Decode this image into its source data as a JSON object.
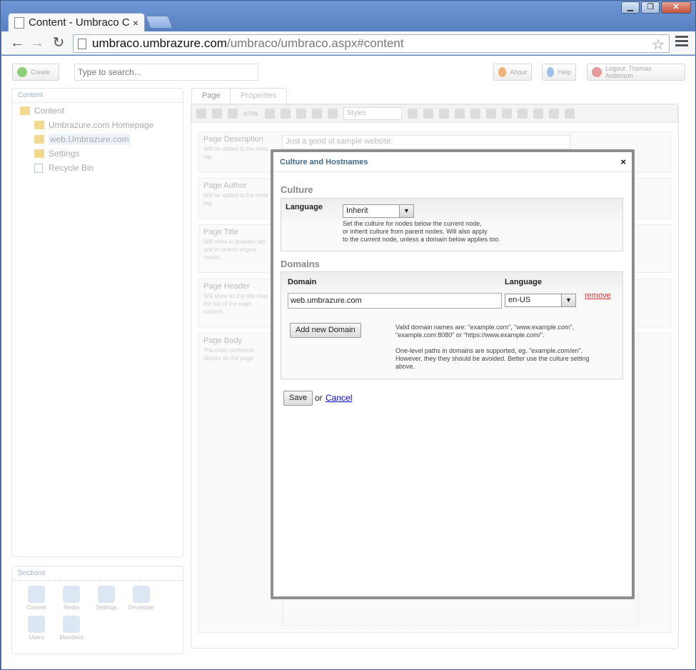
{
  "browser": {
    "tab_title": "Content - Umbraco C",
    "tab_close": "×",
    "url_host": "umbraco.umbrazure.com",
    "url_path": "/umbraco/umbraco.aspx#content",
    "window_buttons": [
      "▁",
      "❐",
      "✕"
    ]
  },
  "topbar": {
    "create_label": "Create",
    "search_placeholder": "Type to search...",
    "about_label": "About",
    "help_label": "Help",
    "logout_label": "Logout: Thomas Anderson"
  },
  "tree": {
    "title": "Content",
    "items": [
      "Content",
      "Umbrazure.com Homepage",
      "web.Umbrazure.com",
      "Settings",
      "Recycle Bin"
    ]
  },
  "sections": {
    "title": "Sections",
    "items": [
      "Content",
      "Media",
      "Settings",
      "Developer",
      "Users",
      "Members"
    ]
  },
  "page_tabs": [
    "Page",
    "Properties"
  ],
  "editor": {
    "styles_label": "Styles",
    "html_label": "HTML"
  },
  "properties": [
    {
      "label": "Page Description",
      "desc": "Will be added to the meta tag.",
      "value": "Just a good ol sample website."
    },
    {
      "label": "Page Author",
      "desc": "Will be added to the meta tag.",
      "value": ""
    },
    {
      "label": "Page Title",
      "desc": "Will show in browser tab and in search engine results.",
      "value": ""
    },
    {
      "label": "Page Header",
      "desc": "Will show as the title near the top of the page content.",
      "value": ""
    },
    {
      "label": "Page Body",
      "desc": "The main content to display on the page.",
      "value": ""
    }
  ],
  "modal": {
    "title": "Culture and Hostnames",
    "close": "×",
    "culture_title": "Culture",
    "language_label": "Language",
    "language_value": "Inherit",
    "language_hint": [
      "Set the culture for nodes below the current node,",
      "or inherit culture from parent nodes. Will also apply",
      "to the current node, unless a domain below applies too."
    ],
    "domains_title": "Domains",
    "domain_col": "Domain",
    "domain_lang_col": "Language",
    "domain_value": "web.umbrazure.com",
    "domain_lang_value": "en-US",
    "remove_label": "remove",
    "add_label": "Add new Domain",
    "domain_hint_1": [
      "Valid domain names are: \"example.com\", \"www.example.com\",",
      "\"example.com:8080\" or \"https://www.example.com/\"."
    ],
    "domain_hint_2": [
      "One-level paths in domains are supported, eg. \"example.com/en\".",
      "However, they they should be avoided. Better use the culture setting",
      "above."
    ],
    "save_label": "Save",
    "or_label": "or",
    "cancel_label": "Cancel"
  }
}
